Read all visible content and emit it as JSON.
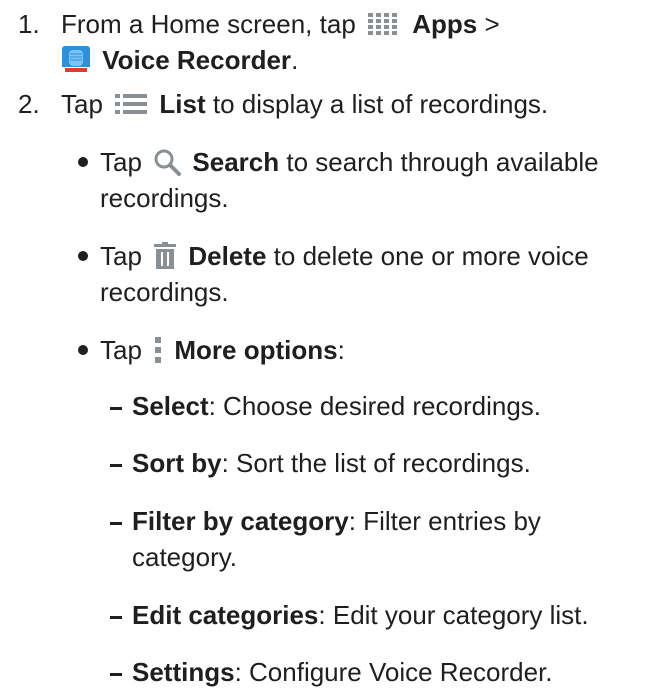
{
  "step1": {
    "number": "1.",
    "prefix": "From a Home screen, tap",
    "apps_label": "Apps",
    "separator": ">",
    "voice_label": "Voice Recorder",
    "suffix": ".",
    "apps_icon": "apps-grid-icon",
    "voice_icon": "voice-recorder-icon"
  },
  "step2": {
    "number": "2.",
    "prefix": "Tap",
    "list_label": "List",
    "suffix": "to display a list of recordings.",
    "list_icon": "list-icon"
  },
  "bullets": [
    {
      "prefix": "Tap",
      "label": "Search",
      "suffix": "to search through available recordings.",
      "icon": "search-icon"
    },
    {
      "prefix": "Tap",
      "label": "Delete",
      "suffix": "to delete one or more voice recordings.",
      "icon": "trash-icon"
    },
    {
      "prefix": "Tap",
      "label": "More options",
      "suffix": ":",
      "icon": "more-options-icon"
    }
  ],
  "options": [
    {
      "label": "Select",
      "description": ": Choose desired recordings."
    },
    {
      "label": "Sort by",
      "description": ": Sort the list of recordings."
    },
    {
      "label": "Filter by category",
      "description": ": Filter entries by category."
    },
    {
      "label": "Edit categories",
      "description": ": Edit your category list."
    },
    {
      "label": "Settings",
      "description": ": Configure Voice Recorder."
    }
  ],
  "colors": {
    "text": "#1f1f1f",
    "icon_gray": "#8a8f94",
    "recorder_blue": "#2f8fd8",
    "recorder_red": "#e23b2e"
  }
}
